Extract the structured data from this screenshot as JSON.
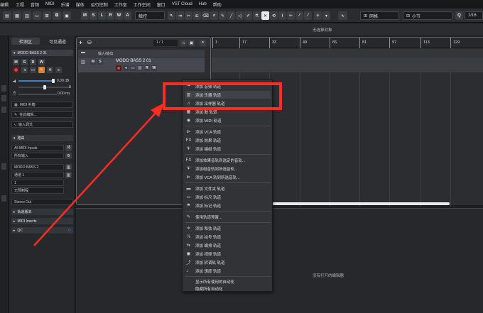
{
  "menubar": [
    "编辑",
    "工程",
    "音频",
    "MIDI",
    "乐谱",
    "媒体",
    "运行控制",
    "工作室",
    "工作空间",
    "窗口",
    "VST Cloud",
    "Hub",
    "帮助"
  ],
  "toolbar": {
    "mode_buttons": [
      "M",
      "S",
      "L",
      "R",
      "W",
      "A"
    ],
    "touch_mode": "触控",
    "grid_label": "网格",
    "quantize_label": "小节",
    "q_label": "Q",
    "quantize_value": "1/16"
  },
  "status_text": "无选择对象",
  "inspector": {
    "tabs": [
      "检测区",
      "可见通道"
    ],
    "track_name": "MODO BASS 2 01",
    "mute": "M",
    "solo": "S",
    "read": "R",
    "write": "W",
    "volume": "0.00 dB",
    "pan": "0",
    "delay": "0.00 ms",
    "midi_out_label": "MIDI 补箱",
    "edit_in_place": "在此编辑...",
    "keep_input": "输入调式",
    "routing_section": "路由",
    "midi_input": "All MIDI Inputs",
    "channel_in": "所有输入",
    "instrument": "MODO BASS 2",
    "channel_out": "通道 1",
    "channel_num": "1",
    "program": "无预制程",
    "audio_out": "Stereo Out",
    "sections": [
      "轨道版本",
      "MIDI Inserts",
      "QC"
    ]
  },
  "tracklist": {
    "counter": "1 / 1",
    "folder_name": "输入/输出",
    "track_name": "MODO BASS 2 01",
    "buttons": [
      "M",
      "S",
      "R",
      "W"
    ]
  },
  "ruler": [
    "1",
    "17",
    "33",
    "49",
    "65",
    "81",
    "97",
    "113",
    "129"
  ],
  "editor_empty": "没有打开的编辑器",
  "context_menu": {
    "items": [
      {
        "icon": "audio-track-icon",
        "glyph": "⏦",
        "label": "添加 音频 轨道"
      },
      {
        "icon": "instrument-track-icon",
        "glyph": "▥",
        "label": "添加 乐器 轨道"
      },
      {
        "icon": "sampler-track-icon",
        "glyph": "♫",
        "label": "添加 采样器 轨道"
      },
      {
        "icon": "drum-track-icon",
        "glyph": "▦",
        "label": "添加 鼓 轨道"
      },
      {
        "icon": "midi-track-icon",
        "glyph": "◉",
        "label": "添加 MIDI 轨道"
      },
      {
        "icon": "vca-track-icon",
        "glyph": "⧐",
        "label": "添加 VCA 轨道"
      },
      {
        "icon": "fx-track-icon",
        "glyph": "FX",
        "label": "添加 效果 轨道"
      },
      {
        "icon": "group-track-icon",
        "glyph": "Ψ",
        "label": "添加 编组 轨道"
      },
      {
        "icon": "fx-selected-icon",
        "glyph": "FX",
        "label": "添加效果音轨到选定的音轨..."
      },
      {
        "icon": "group-selected-icon",
        "glyph": "Ψ",
        "label": "添加组音轨到所选音轨..."
      },
      {
        "icon": "vca-selected-icon",
        "glyph": "⧐",
        "label": "添加 VCA 轨到所选音轨..."
      },
      {
        "icon": "folder-track-icon",
        "glyph": "▬",
        "label": "添加 文件夹 轨道"
      },
      {
        "icon": "ruler-track-icon",
        "glyph": "▭",
        "label": "添加 标尺 轨道"
      },
      {
        "icon": "marker-track-icon",
        "glyph": "⚑",
        "label": "添加 标记 轨道"
      },
      {
        "icon": "preset-icon",
        "glyph": "✎",
        "label": "使用轨道预置..."
      },
      {
        "icon": "chord-track-icon",
        "glyph": "≑",
        "label": "添加 和弦 轨道"
      },
      {
        "icon": "signature-track-icon",
        "glyph": "⅞",
        "label": "添加 拍号 轨道"
      },
      {
        "icon": "arranger-track-icon",
        "glyph": "⇆",
        "label": "添加 编排 轨道"
      },
      {
        "icon": "video-track-icon",
        "glyph": "▣",
        "label": "添加 视频 轨道"
      },
      {
        "icon": "transpose-track-icon",
        "glyph": "⤴",
        "label": "添加 转调轨 轨道"
      },
      {
        "icon": "tempo-track-icon",
        "glyph": "♩",
        "label": "添加 速度 轨道"
      },
      {
        "icon": "",
        "glyph": "",
        "label": "显示所有使用的自动化"
      },
      {
        "icon": "",
        "glyph": "",
        "label": "隐藏所有自动化"
      }
    ]
  },
  "colors": {
    "highlight": "#ff2d21",
    "record": "#e23b3b",
    "accent_blue": "#3d7fd6"
  }
}
